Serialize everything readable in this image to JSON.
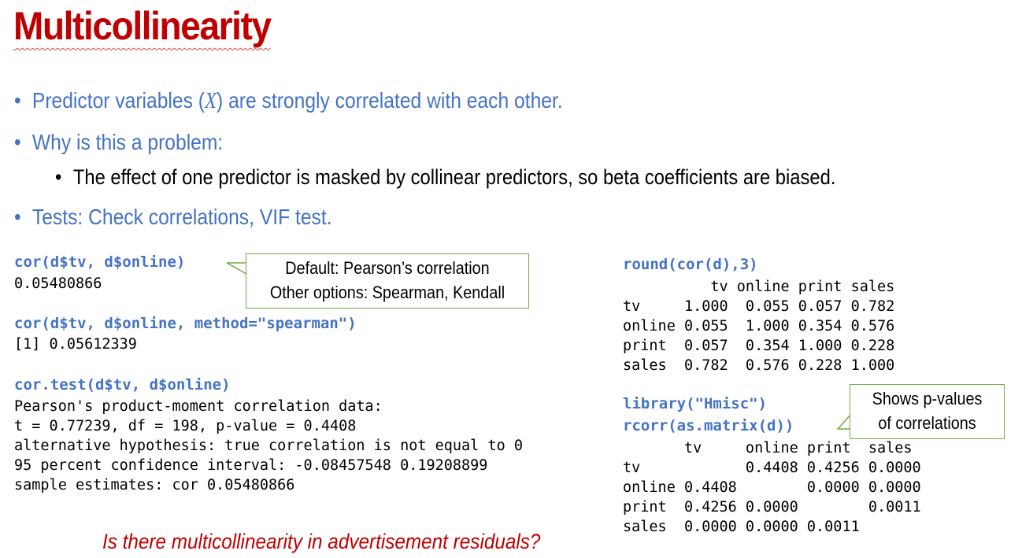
{
  "title": "Multicollinearity",
  "bullets": {
    "b1_pre": "Predictor variables (",
    "b1_var": "X",
    "b1_post": ") are strongly correlated with each other.",
    "b2": "Why is this a problem:",
    "b2_sub": "The effect of one predictor is masked by collinear predictors, so beta coefficients are biased.",
    "b3": "Tests: Check correlations, VIF test."
  },
  "left_code": {
    "cmd1": "cor(d$tv, d$online)",
    "out1": "0.05480866",
    "cmd2": "cor(d$tv, d$online, method=\"spearman\")",
    "out2": "[1] 0.05612339",
    "cmd3": "cor.test(d$tv, d$online)",
    "out3": "Pearson's product-moment correlation data:\nt = 0.77239, df = 198, p-value = 0.4408\nalternative hypothesis: true correlation is not equal to 0\n95 percent confidence interval: -0.08457548 0.19208899\nsample estimates: cor 0.05480866"
  },
  "callout1": {
    "line1": "Default: Pearson’s correlation",
    "line2": "Other options: Spearman, Kendall"
  },
  "right_code": {
    "cmd1": "round(cor(d),3)",
    "out1": "          tv online print sales\ntv     1.000  0.055 0.057 0.782\nonline 0.055  1.000 0.354 0.576\nprint  0.057  0.354 1.000 0.228\nsales  0.782  0.576 0.228 1.000",
    "cmd2": "library(\"Hmisc\")",
    "cmd3": "rcorr(as.matrix(d))",
    "out2": "       tv     online print  sales\ntv            0.4408 0.4256 0.0000\nonline 0.4408        0.0000 0.0000\nprint  0.4256 0.0000        0.0011\nsales  0.0000 0.0000 0.0011"
  },
  "callout2": {
    "line1": "Shows p-values",
    "line2": "of correlations"
  },
  "question": "Is there multicollinearity in advertisement residuals?",
  "colors": {
    "title": "#C00000",
    "bullet": "#4472C4",
    "code": "#4472C4",
    "callout_border": "#70AD47"
  }
}
